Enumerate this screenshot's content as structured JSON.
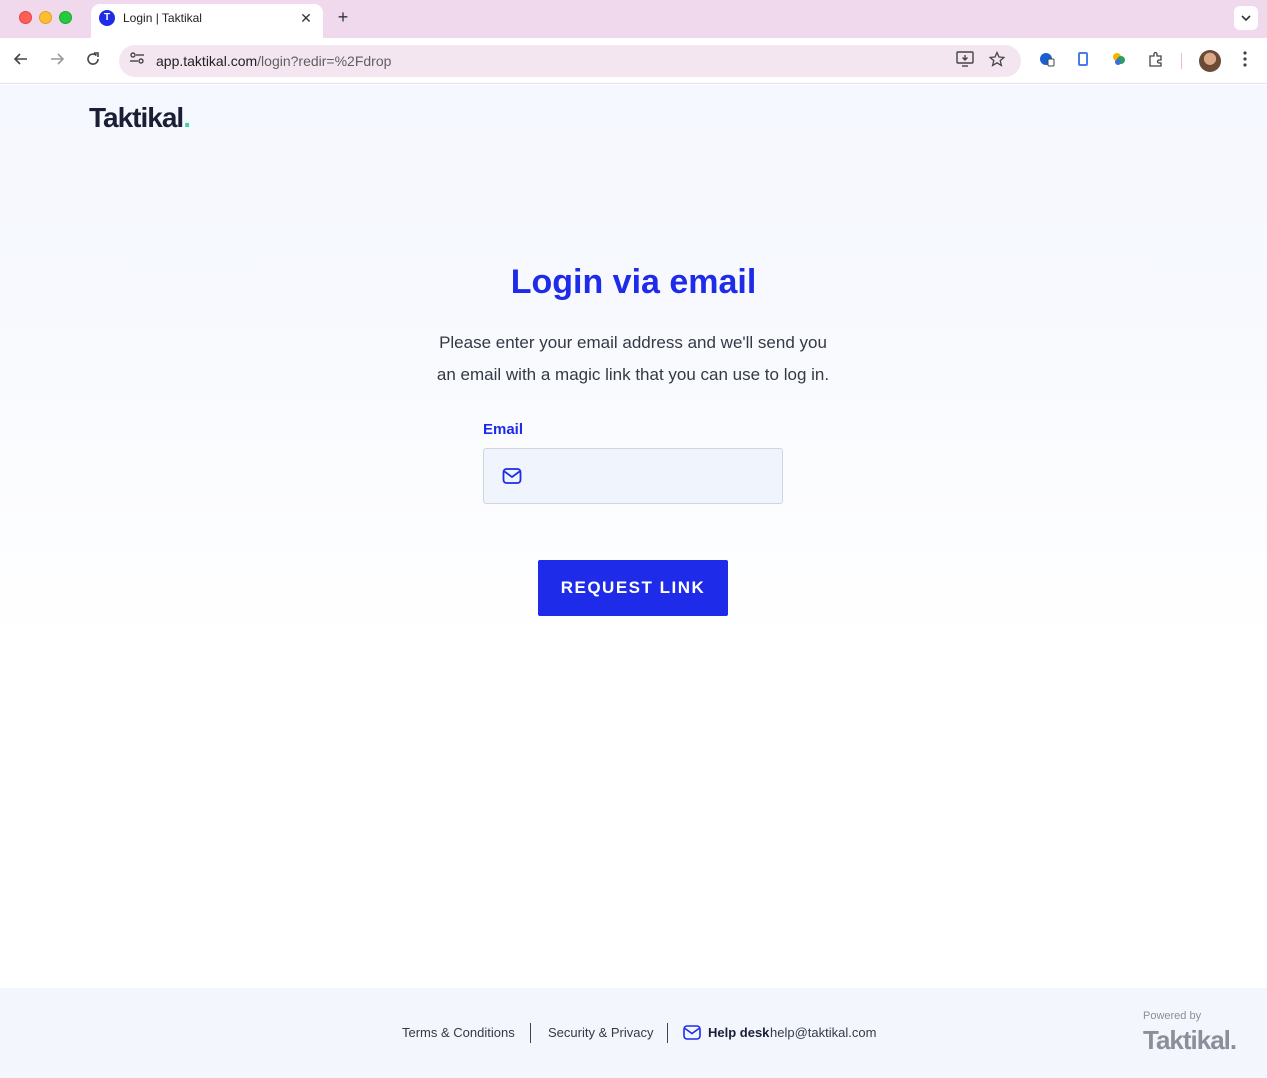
{
  "browser": {
    "tab_title": "Login | Taktikal",
    "tab_favicon_letter": "T",
    "tab_close_glyph": "✕",
    "new_tab_glyph": "+",
    "url_host": "app.taktikal.com",
    "url_path": "/login?redir=%2Fdrop",
    "icons": [
      "back-icon",
      "forward-icon",
      "reload-icon",
      "site-info-icon",
      "install-app-icon",
      "bookmark-star-icon",
      "extension-icon",
      "extensions-puzzle-icon",
      "profile-avatar",
      "more-menu-icon",
      "tab-search-icon"
    ]
  },
  "header": {
    "brand": "Taktikal",
    "brand_dot": "."
  },
  "login": {
    "title": "Login via email",
    "description_line1": "Please enter your email address and we'll send you",
    "description_line2": "an email with a magic link that you can use to log in.",
    "email_label": "Email",
    "email_value": "",
    "email_placeholder": "",
    "submit_label": "REQUEST LINK"
  },
  "footer": {
    "terms": "Terms & Conditions",
    "security": "Security & Privacy",
    "help_label": "Help desk",
    "help_email": "help@taktikal.com",
    "powered_by": "Powered by",
    "powered_brand": "Taktikal",
    "powered_dot": "."
  },
  "colors": {
    "accent": "#1e2be8",
    "brand_dot": "#3dd6a3",
    "tabstrip": "#f0d9ec"
  }
}
